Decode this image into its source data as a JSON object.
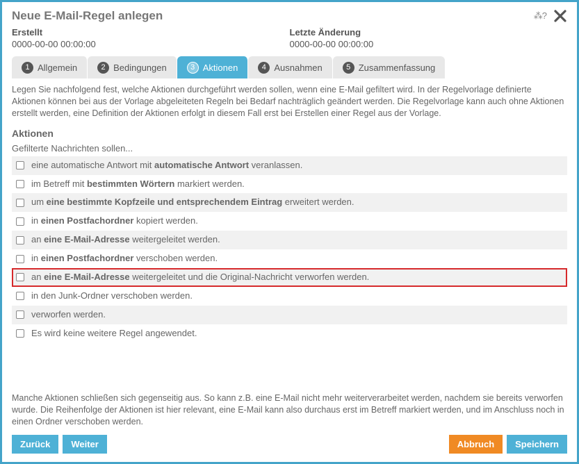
{
  "modal": {
    "title": "Neue E-Mail-Regel anlegen",
    "meta": {
      "created_label": "Erstellt",
      "created_value": "0000-00-00 00:00:00",
      "modified_label": "Letzte Änderung",
      "modified_value": "0000-00-00 00:00:00"
    }
  },
  "tabs": [
    {
      "num": "1",
      "label": "Allgemein"
    },
    {
      "num": "2",
      "label": "Bedingungen"
    },
    {
      "num": "3",
      "label": "Aktionen"
    },
    {
      "num": "4",
      "label": "Ausnahmen"
    },
    {
      "num": "5",
      "label": "Zusammenfassung"
    }
  ],
  "description": "Legen Sie nachfolgend fest, welche Aktionen durchgeführt werden sollen, wenn eine E-Mail gefiltert wird. In der Regelvorlage definierte Aktionen können bei aus der Vorlage abgeleiteten Regeln bei Bedarf nachträglich geändert werden. Die Regelvorlage kann auch ohne Aktionen erstellt werden, eine Definition der Aktionen erfolgt in diesem Fall erst bei Erstellen einer Regel aus der Vorlage.",
  "section_title": "Aktionen",
  "sub_label": "Gefilterte Nachrichten sollen...",
  "actions": [
    {
      "pre": "eine automatische Antwort mit ",
      "bold": "automatische Antwort",
      "post": " veranlassen."
    },
    {
      "pre": "im Betreff mit ",
      "bold": "bestimmten Wörtern",
      "post": " markiert werden."
    },
    {
      "pre": "um ",
      "bold": "eine bestimmte Kopfzeile und entsprechendem Eintrag",
      "post": " erweitert werden."
    },
    {
      "pre": "in ",
      "bold": "einen Postfachordner",
      "post": " kopiert werden."
    },
    {
      "pre": "an ",
      "bold": "eine E-Mail-Adresse",
      "post": " weitergeleitet werden."
    },
    {
      "pre": "in ",
      "bold": "einen Postfachordner",
      "post": " verschoben werden."
    },
    {
      "pre": "an ",
      "bold": "eine E-Mail-Adresse",
      "post": " weitergeleitet und die Original-Nachricht verworfen werden."
    },
    {
      "pre": "in den Junk-Ordner verschoben werden.",
      "bold": "",
      "post": ""
    },
    {
      "pre": "verworfen werden.",
      "bold": "",
      "post": ""
    },
    {
      "pre": "Es wird keine weitere Regel angewendet.",
      "bold": "",
      "post": ""
    }
  ],
  "highlight_index": 6,
  "footnote": "Manche Aktionen schließen sich gegenseitig aus. So kann z.B. eine E-Mail nicht mehr weiterverarbeitet werden, nachdem sie bereits verworfen wurde. Die Reihenfolge der Aktionen ist hier relevant, eine E-Mail kann also durchaus erst im Betreff markiert werden, und im Anschluss noch in einen Ordner verschoben werden.",
  "buttons": {
    "back": "Zurück",
    "next": "Weiter",
    "cancel": "Abbruch",
    "save": "Speichern"
  }
}
